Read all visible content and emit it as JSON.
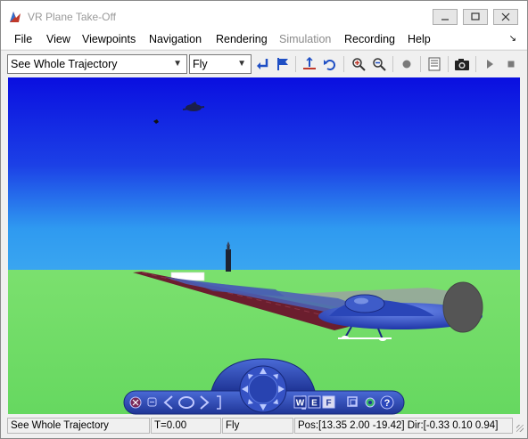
{
  "window": {
    "title": "VR Plane Take-Off"
  },
  "menu": {
    "items": [
      {
        "label": "File",
        "enabled": true
      },
      {
        "label": "View",
        "enabled": true
      },
      {
        "label": "Viewpoints",
        "enabled": true
      },
      {
        "label": "Navigation",
        "enabled": true
      },
      {
        "label": "Rendering",
        "enabled": true
      },
      {
        "label": "Simulation",
        "enabled": false
      },
      {
        "label": "Recording",
        "enabled": true
      },
      {
        "label": "Help",
        "enabled": true
      }
    ]
  },
  "toolbar": {
    "viewpoint_select": "See Whole Trajectory",
    "navigation_select": "Fly",
    "icons": [
      "return-to-viewpoint-icon",
      "create-viewpoint-flag-icon",
      "straighten-up-icon",
      "undo-move-icon",
      "zoom-in-icon",
      "zoom-out-icon",
      "record-icon",
      "capture-frame-icon",
      "snapshot-camera-icon",
      "play-icon",
      "stop-icon"
    ]
  },
  "nav_panel": {
    "buttons": [
      "close-panel-icon",
      "minimize-panel-icon",
      "left-arrow-icon",
      "rotate-icon",
      "right-arrow-icon",
      "direction-pad-icon",
      "wireframe-button",
      "headlight-button",
      "fly-mode-button",
      "window-icon",
      "settings-icon",
      "help-icon"
    ],
    "labels": {
      "w": "W",
      "e": "E",
      "f": "F",
      "help": "?"
    }
  },
  "status": {
    "viewpoint": "See Whole Trajectory",
    "time": "T=0.00",
    "mode": "Fly",
    "position": "Pos:[13.35 2.00 -19.42] Dir:[-0.33 0.10 0.94]"
  },
  "colors": {
    "sky_top": "#0a0fe0",
    "sky_bottom": "#2f9af0",
    "ground": "#6fe06a",
    "runway": "#6b1e2e",
    "plane_body": "#2a46b8"
  }
}
